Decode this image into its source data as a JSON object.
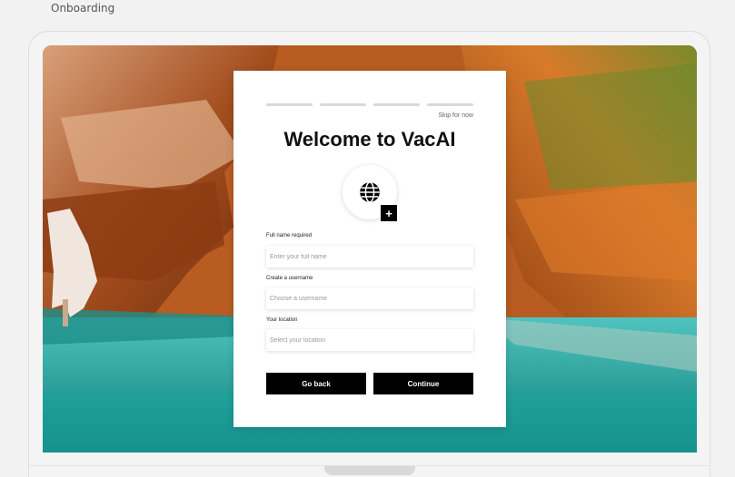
{
  "page": {
    "label": "Onboarding"
  },
  "onboarding": {
    "skip_label": "Skip for now",
    "title": "Welcome to VacAI",
    "steps_total": 4,
    "avatar_icon": "globe-icon",
    "add_icon": "plus-icon",
    "add_label": "+",
    "fields": {
      "full_name": {
        "label": "Full name required",
        "placeholder": "Enter your full name",
        "value": ""
      },
      "username": {
        "label": "Create a username",
        "placeholder": "Choose a username",
        "value": ""
      },
      "location": {
        "label": "Your location",
        "placeholder": "Select your location",
        "value": ""
      }
    },
    "buttons": {
      "back_label": "Go back",
      "continue_label": "Continue"
    }
  },
  "colors": {
    "button_bg": "#000000",
    "card_bg": "#ffffff",
    "page_bg": "#f2f2f2"
  }
}
